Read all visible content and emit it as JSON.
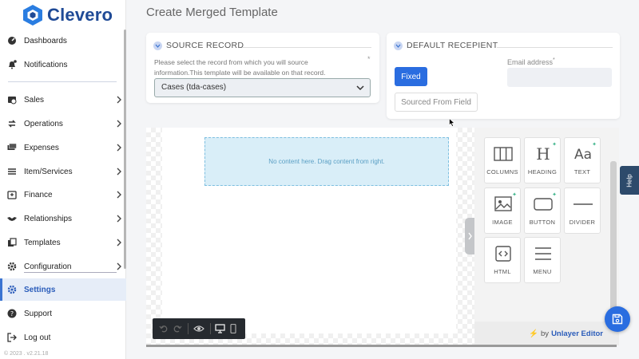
{
  "app": {
    "name": "Clevero",
    "version": "© 2023 . v2.21.18"
  },
  "sidebar": {
    "items": [
      {
        "label": "Dashboards",
        "icon": "dashboard-icon"
      },
      {
        "label": "Notifications",
        "icon": "bell-icon"
      },
      {
        "label": "Sales",
        "icon": "sales-icon"
      },
      {
        "label": "Operations",
        "icon": "operations-icon"
      },
      {
        "label": "Expenses",
        "icon": "expenses-icon"
      },
      {
        "label": "Item/Services",
        "icon": "list-icon"
      },
      {
        "label": "Finance",
        "icon": "finance-icon"
      },
      {
        "label": "Relationships",
        "icon": "handshake-icon"
      },
      {
        "label": "Templates",
        "icon": "templates-icon"
      },
      {
        "label": "Configuration",
        "icon": "gear-icon"
      },
      {
        "label": "Settings",
        "icon": "gear-icon",
        "active": true
      },
      {
        "label": "Support",
        "icon": "help-circle-icon"
      },
      {
        "label": "Log out",
        "icon": "logout-icon"
      }
    ]
  },
  "page": {
    "title": "Create Merged Template"
  },
  "source_record": {
    "heading": "SOURCE RECORD",
    "description": "Please select the record from which you will source information.This template will be available on that record.",
    "required_mark": "*",
    "selected_value": "Cases (tda-cases)"
  },
  "default_recipient": {
    "heading": "DEFAULT RECEPIENT",
    "fixed_label": "Fixed",
    "sourced_label": "Sourced From Field",
    "email_label": "Email address",
    "required_mark": "*",
    "email_value": ""
  },
  "editor": {
    "dropzone_text": "No content here. Drag content from right.",
    "tools": [
      {
        "label": "COLUMNS",
        "icon": "columns-icon",
        "spark": false
      },
      {
        "label": "HEADING",
        "icon": "heading-icon",
        "spark": true
      },
      {
        "label": "TEXT",
        "icon": "text-icon",
        "spark": true
      },
      {
        "label": "IMAGE",
        "icon": "image-icon",
        "spark": true
      },
      {
        "label": "BUTTON",
        "icon": "button-icon",
        "spark": true
      },
      {
        "label": "DIVIDER",
        "icon": "divider-icon",
        "spark": false
      },
      {
        "label": "HTML",
        "icon": "html-icon",
        "spark": false
      },
      {
        "label": "MENU",
        "icon": "menu-icon",
        "spark": false
      }
    ],
    "branding_by": "by",
    "branding_name": "Unlayer Editor"
  },
  "help": {
    "label": "Help"
  },
  "colors": {
    "accent": "#2a6de0",
    "brand": "#1f4a96",
    "active_bg": "#e6edf8"
  }
}
